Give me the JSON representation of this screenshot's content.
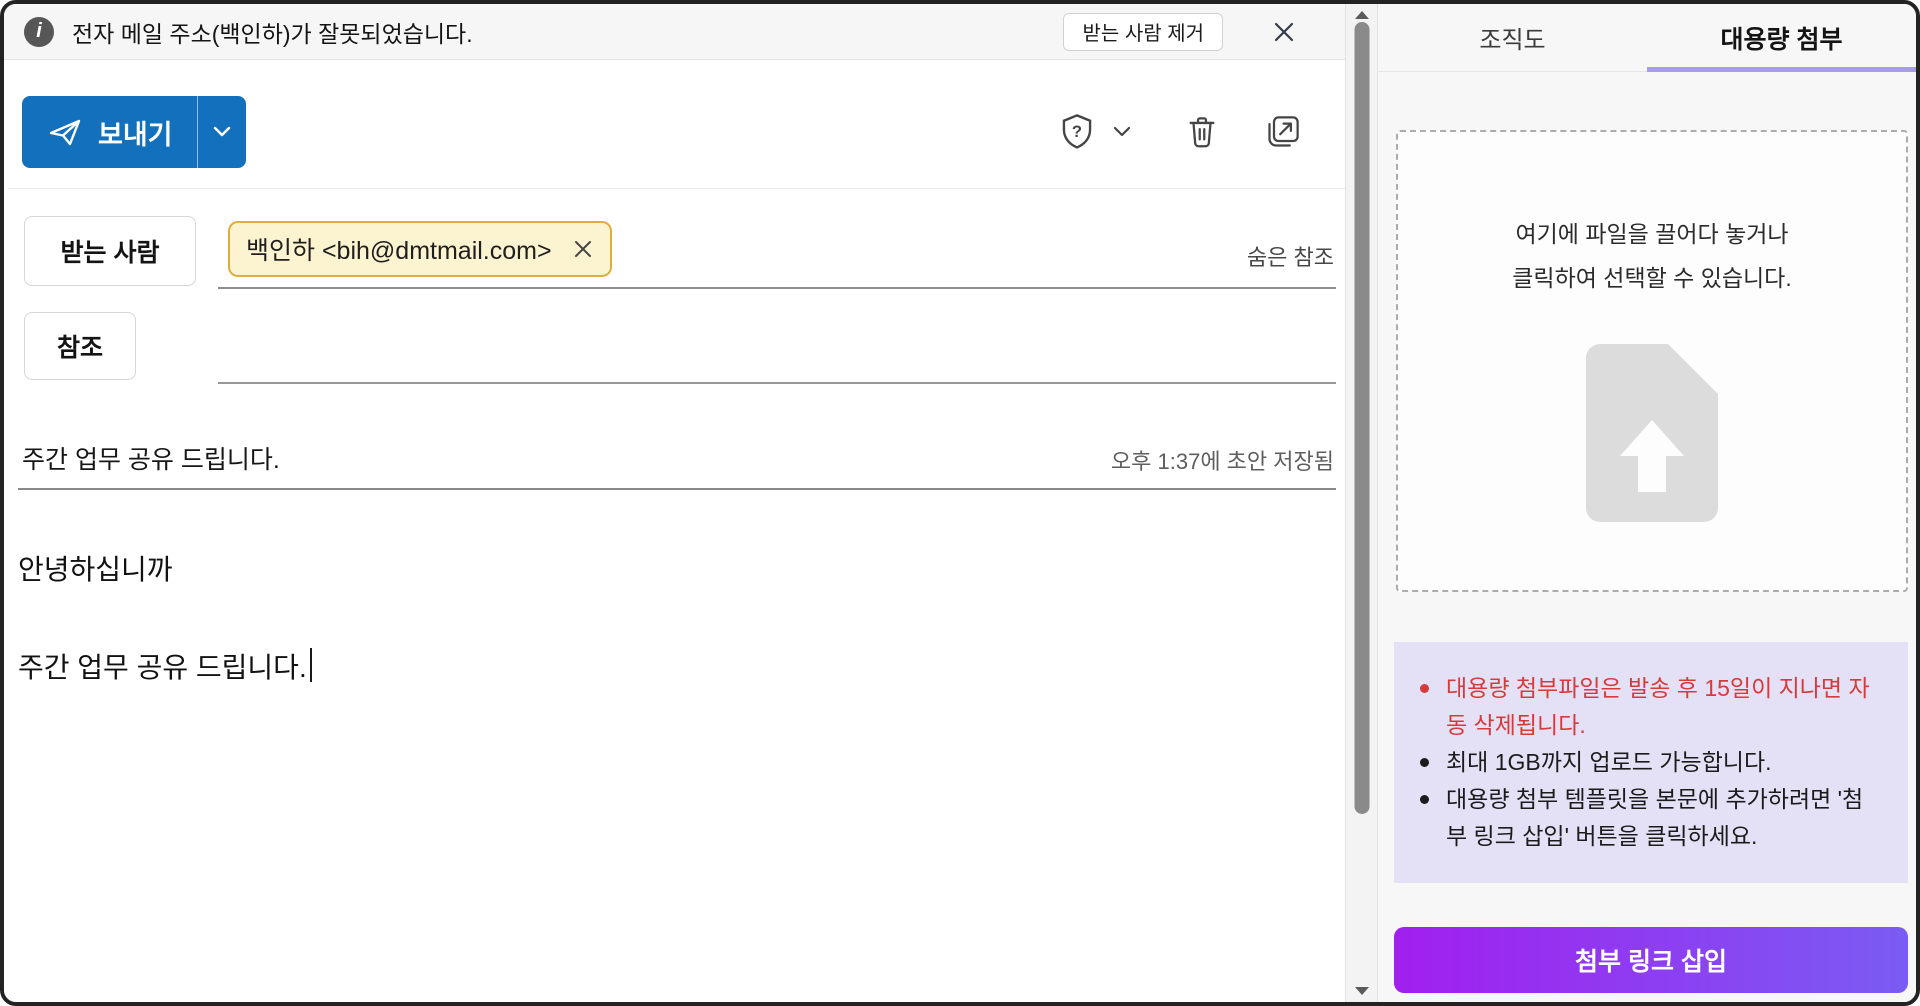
{
  "banner": {
    "message": "전자 메일 주소(백인하)가 잘못되었습니다.",
    "remove_recipient_button": "받는 사람 제거"
  },
  "toolbar": {
    "send_label": "보내기"
  },
  "compose": {
    "to_label": "받는 사람",
    "recipient_chip": "백인하 <bih@dmtmail.com>",
    "bcc_label": "숨은 참조",
    "cc_label": "참조",
    "subject": "주간 업무 공유 드립니다.",
    "draft_status": "오후 1:37에 초안 저장됨",
    "body": {
      "line1": "안녕하십니까",
      "line2": "주간 업무 공유 드립니다."
    }
  },
  "side_panel": {
    "tabs": [
      {
        "label": "조직도",
        "active": false
      },
      {
        "label": "대용량 첨부",
        "active": true
      }
    ],
    "dropzone": {
      "line1": "여기에 파일을 끌어다 놓거나",
      "line2": "클릭하여 선택할 수 있습니다."
    },
    "notes": [
      {
        "text": "대용량 첨부파일은 발송 후 15일이 지나면 자동 삭제됩니다.",
        "emphasis": "red"
      },
      {
        "text": "최대 1GB까지 업로드 가능합니다.",
        "emphasis": "normal"
      },
      {
        "text": "대용량 첨부 템플릿을 본문에 추가하려면 '첨부 링크 삽입' 버튼을 클릭하세요.",
        "emphasis": "normal"
      }
    ],
    "insert_link_button": "첨부 링크 삽입"
  },
  "icons": {
    "info-icon": "i",
    "close-icon": "✕",
    "send-icon": "paper-plane",
    "chevron-down-icon": "⌄",
    "shield-question-icon": "shield-?",
    "trash-icon": "trash-can",
    "open-in-new-window-icon": "↗",
    "chip-remove-icon": "✕",
    "file-upload-icon": "document-upload-arrow",
    "scroll-up-icon": "▲",
    "scroll-down-icon": "▼"
  },
  "colors": {
    "send_button_blue": "#1270BD",
    "chip_background": "#FCF4D1",
    "chip_border": "#DFAE3C",
    "active_tab_underline": "#A79BF0",
    "notes_background": "#E4E1F6",
    "warning_text_red": "#D63A3A",
    "insert_button_gradient_start": "#A11FEF",
    "insert_button_gradient_end": "#7A5CF3"
  }
}
